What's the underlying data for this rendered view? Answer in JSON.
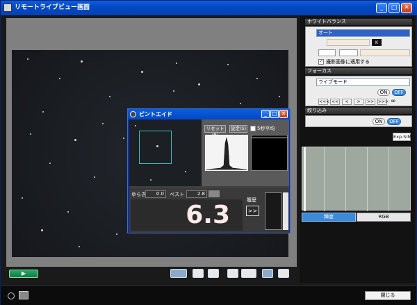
{
  "window": {
    "title": "リモートライブビュー画面"
  },
  "focus_aid": {
    "title": "ピントエイド",
    "reset_label": "リセット(R)",
    "setting_label": "設定(S)",
    "avg_label": "5秒平均",
    "fluct_label": "ゆらぎ",
    "fluct_value": "0.0",
    "best_label": "ベスト",
    "best_value": "2.8",
    "current_value": "6.3",
    "history_label": "履歴",
    "more_label": ">>"
  },
  "right_panel": {
    "white_balance": {
      "heading": "ホワイトバランス",
      "mode": "オート",
      "kelvin_unit": "K",
      "apply_label": "撮影画像に適用する"
    },
    "focus": {
      "heading": "フォーカス",
      "mode": "ライブモード",
      "on_label": "ON",
      "off_label": "OFF",
      "nav": [
        "<<<",
        "<<",
        "<",
        ">",
        ">>",
        ">>>"
      ],
      "infinity": "∞"
    },
    "aperture": {
      "heading": "絞り込み",
      "on_label": "ON",
      "off_label": "OFF"
    },
    "expsim_label": "Exp.SIM",
    "tabs": [
      "輝度",
      "RGB"
    ]
  },
  "footer": {
    "close_label": "閉じる"
  }
}
